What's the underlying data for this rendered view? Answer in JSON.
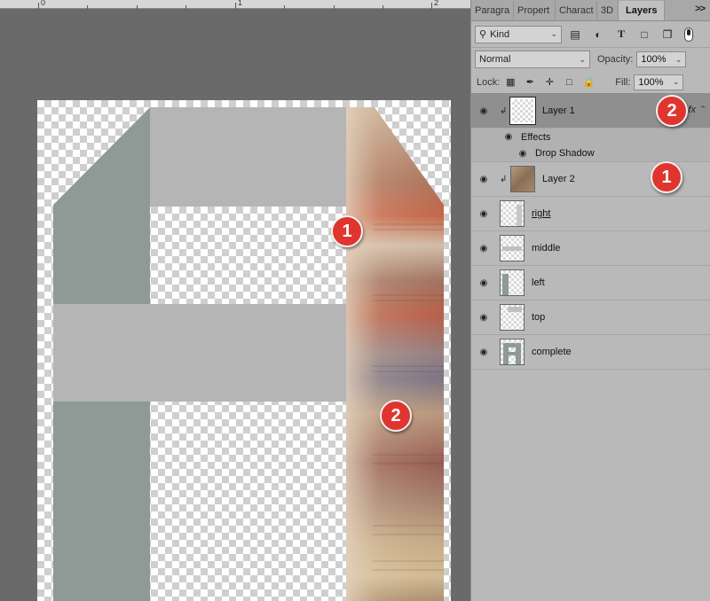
{
  "ruler": {
    "numbers": [
      "0",
      "1",
      "2"
    ]
  },
  "canvas": {
    "badges": [
      "1",
      "2"
    ]
  },
  "panel": {
    "tabs": [
      "Paragra",
      "Propert",
      "Charact",
      "3D",
      "Layers"
    ],
    "more": ">>",
    "filter": {
      "kind": "Kind"
    },
    "blend_mode": "Normal",
    "opacity_label": "Opacity:",
    "opacity_value": "100%",
    "lock_label": "Lock:",
    "fill_label": "Fill:",
    "fill_value": "100%",
    "fx_label": "fx",
    "effects_label": "Effects",
    "drop_shadow_label": "Drop Shadow",
    "layers": [
      {
        "name": "Layer 1",
        "selected": true,
        "clipped": true,
        "fx": true
      },
      {
        "name": "Layer 2",
        "selected": false,
        "clipped": true
      },
      {
        "name": "right"
      },
      {
        "name": "middle"
      },
      {
        "name": "left"
      },
      {
        "name": "top"
      },
      {
        "name": "complete"
      }
    ],
    "badges": [
      "2",
      "1"
    ]
  },
  "colors": {
    "badge": "#e0352e",
    "gray_shape": "#8f9a96",
    "light_gray_bar": "#b5b5b5"
  },
  "icons": [
    "eye-icon",
    "link-clip-icon",
    "image-filter-icon",
    "adjustment-filter-icon",
    "type-filter-icon",
    "shape-filter-icon",
    "smart-object-filter-icon",
    "lock-transparent-icon",
    "lock-paint-icon",
    "lock-move-icon",
    "lock-artboard-icon",
    "lock-all-icon"
  ]
}
